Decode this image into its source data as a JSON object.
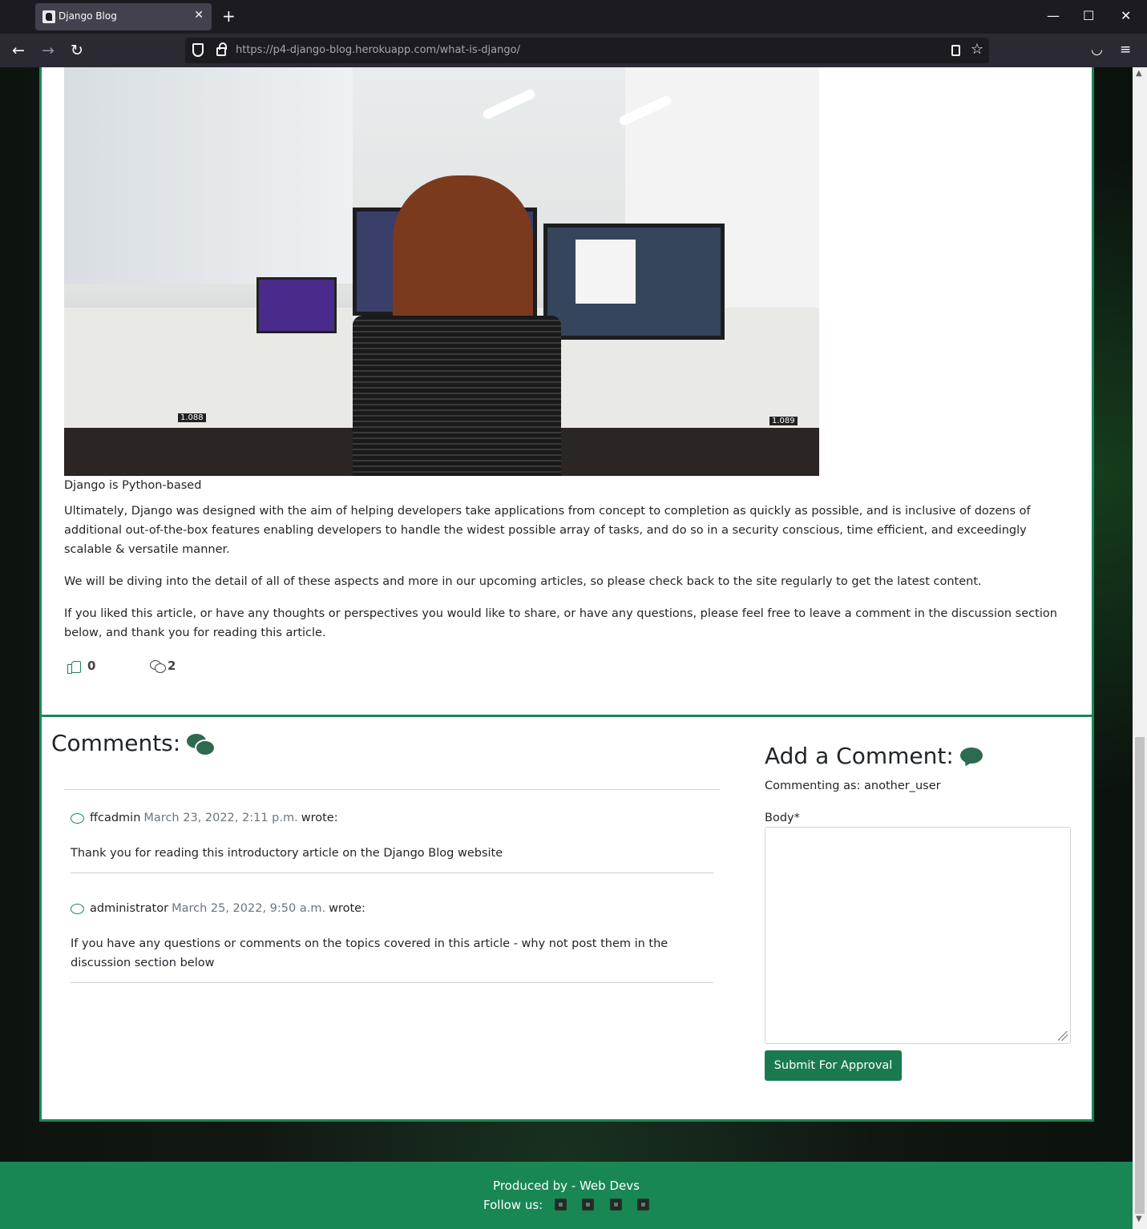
{
  "browser": {
    "tab_title": "Django Blog",
    "tab_close": "✕",
    "new_tab": "+",
    "url_host": "https://p4-django-blog.herokuapp.com",
    "url_path": "/what-is-django/",
    "win_min": "—",
    "win_max": "☐",
    "win_close": "✕",
    "back": "←",
    "forward": "→",
    "reload": "↻",
    "star": "☆",
    "pocket": "◡",
    "menu": "≡"
  },
  "article": {
    "image_labels": [
      "1.088",
      "1.089"
    ],
    "caption": "Django is Python-based",
    "paragraphs": [
      "Ultimately, Django was designed with the aim of helping developers take applications from concept to completion as quickly as possible, and is inclusive of dozens of additional out-of-the-box features enabling developers to handle the widest possible array of tasks, and do so in a security conscious, time efficient, and exceedingly scalable & versatile manner.",
      "We will be diving into the detail of all of these aspects and more in our upcoming articles, so please check back to the site regularly to get the latest content.",
      "If you liked this article, or have any thoughts or perspectives you would like to share, or have any questions, please feel free to leave a comment in the discussion section below, and thank you for reading this article."
    ],
    "likes": "0",
    "comment_count": "2"
  },
  "comments": {
    "title": "Comments:",
    "items": [
      {
        "author": "ffcadmin",
        "date": "March 23, 2022, 2:11 p.m.",
        "suffix": "wrote:",
        "body": "Thank you for reading this introductory article on the Django Blog website"
      },
      {
        "author": "administrator",
        "date": "March 25, 2022, 9:50 a.m.",
        "suffix": "wrote:",
        "body": "If you have any questions or comments on the topics covered in this article - why not post them in the discussion section below"
      }
    ]
  },
  "add_comment": {
    "title": "Add a Comment:",
    "commenting_as": "Commenting as: another_user",
    "body_label": "Body*",
    "body_value": "",
    "submit": "Submit For Approval"
  },
  "footer": {
    "produced_by": "Produced by - Web Devs",
    "follow_us": "Follow us:",
    "social_icons": [
      "facebook-icon",
      "twitter-icon",
      "instagram-icon",
      "youtube-icon"
    ]
  },
  "colors": {
    "brand_green": "#198754",
    "button_green": "#1a7a4f",
    "icon_green": "#2d6a4f"
  }
}
